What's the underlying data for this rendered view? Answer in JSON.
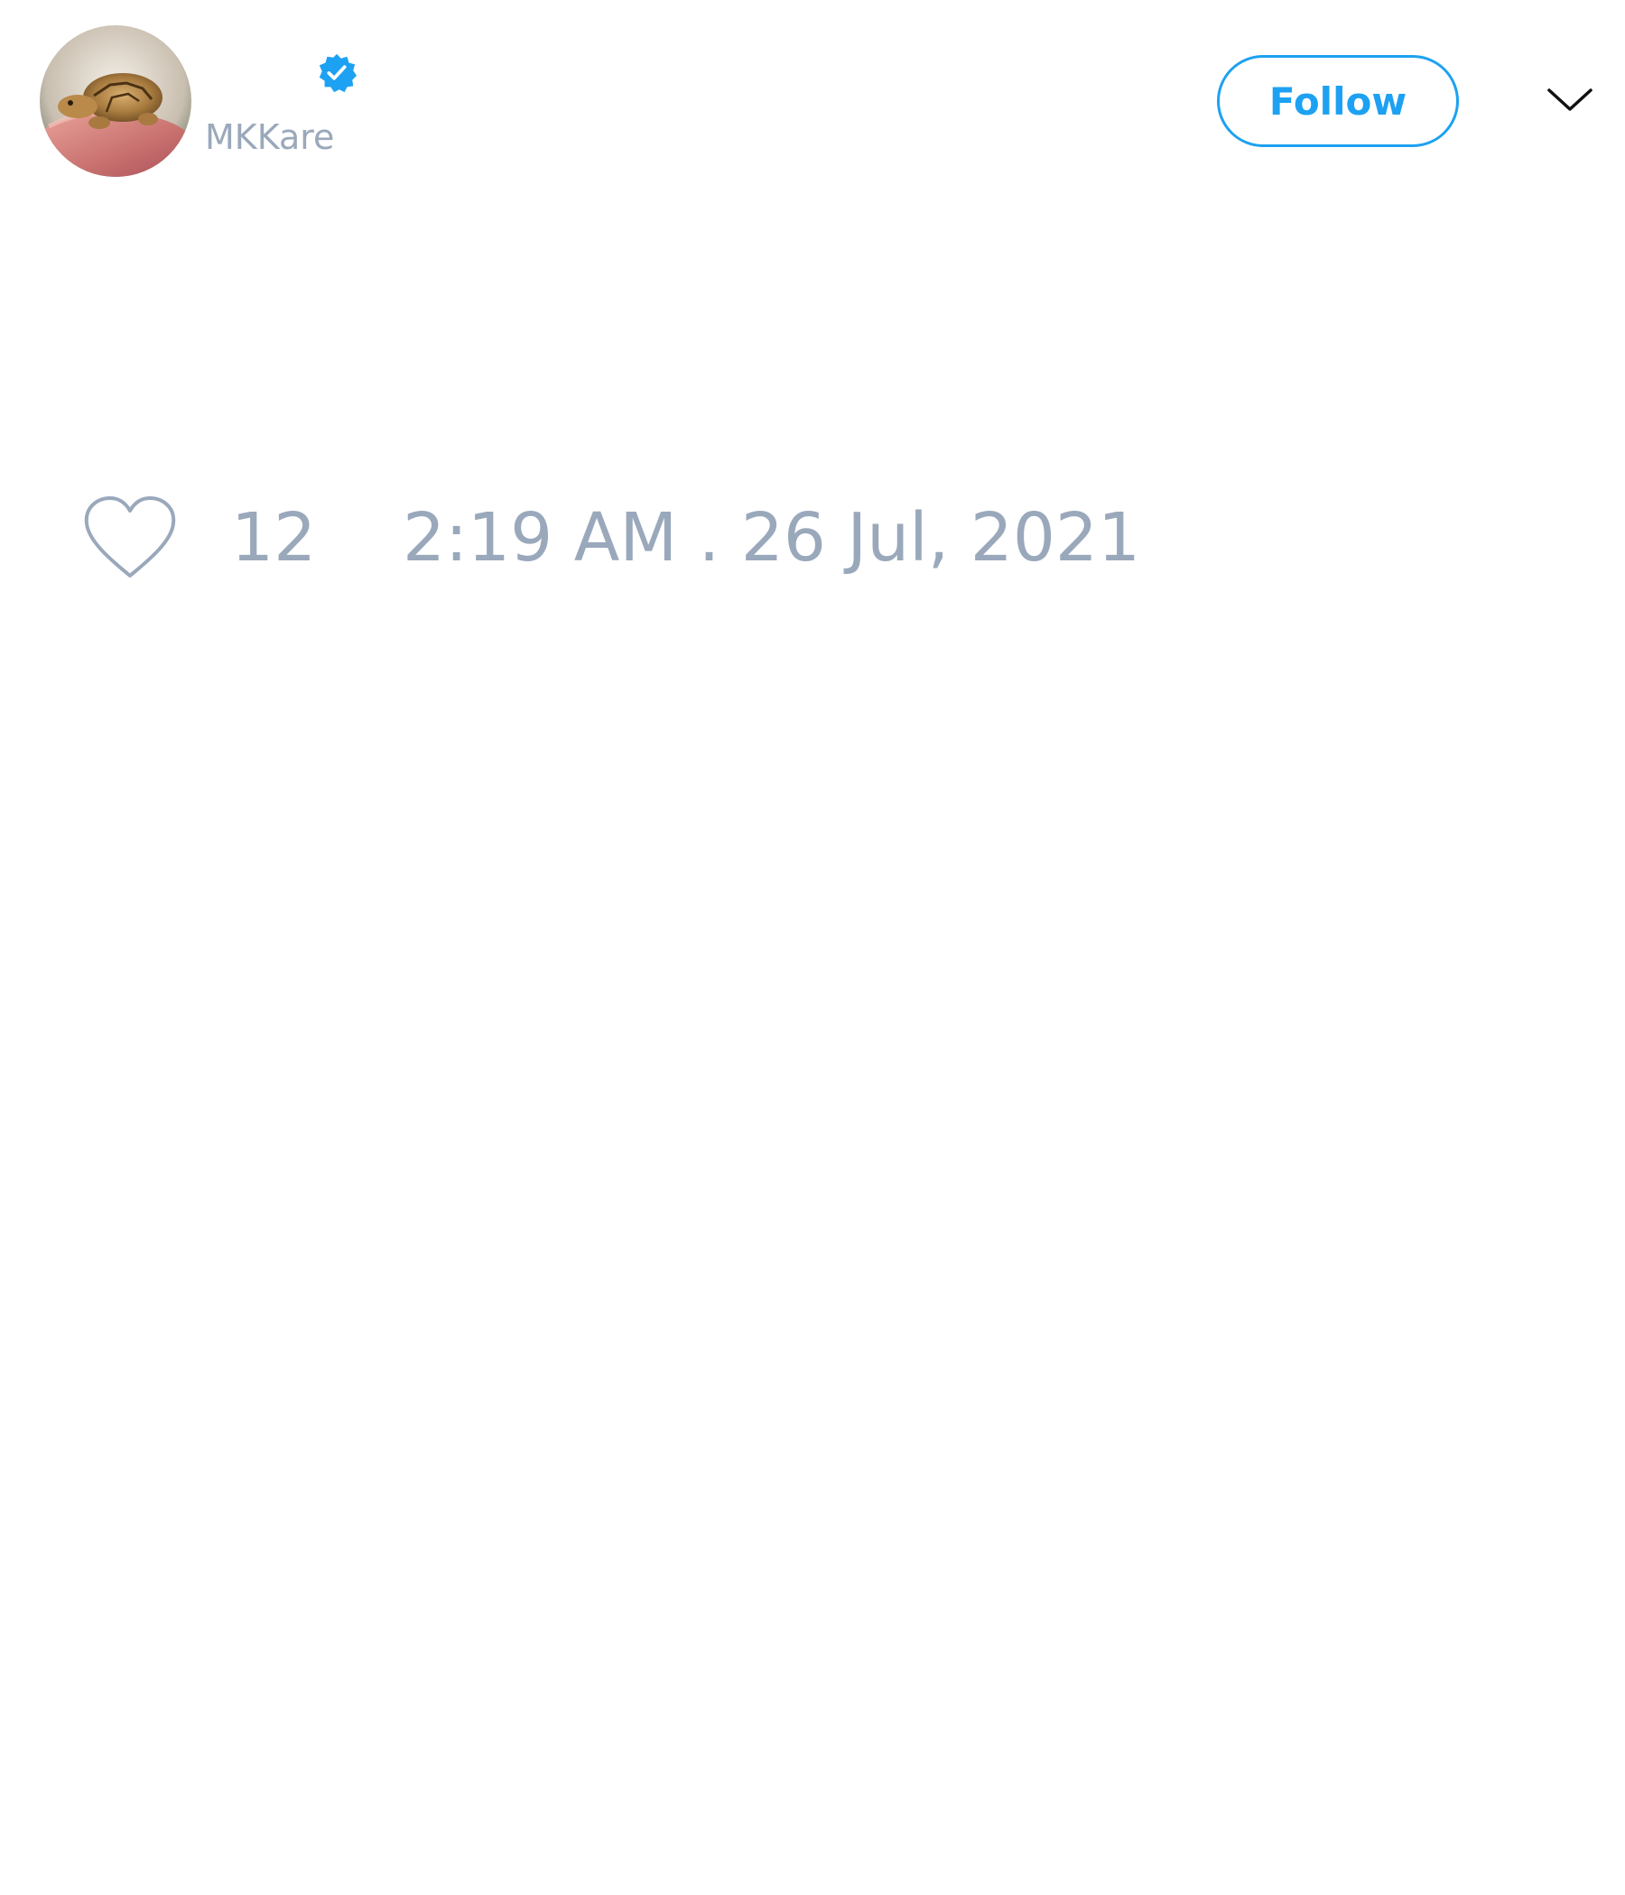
{
  "tweet": {
    "author": {
      "handle": "MKKare",
      "verified": true,
      "avatar_icon": "turtle-avatar-photo"
    },
    "follow_label": "Follow",
    "menu_icon": "chevron-down-icon",
    "like_icon": "heart-outline-icon",
    "like_count": "12",
    "timestamp": "2:19 AM . 26 Jul, 2021"
  },
  "colors": {
    "accent": "#1da1f2",
    "muted_text": "#9aa8bb",
    "background": "#ffffff"
  }
}
